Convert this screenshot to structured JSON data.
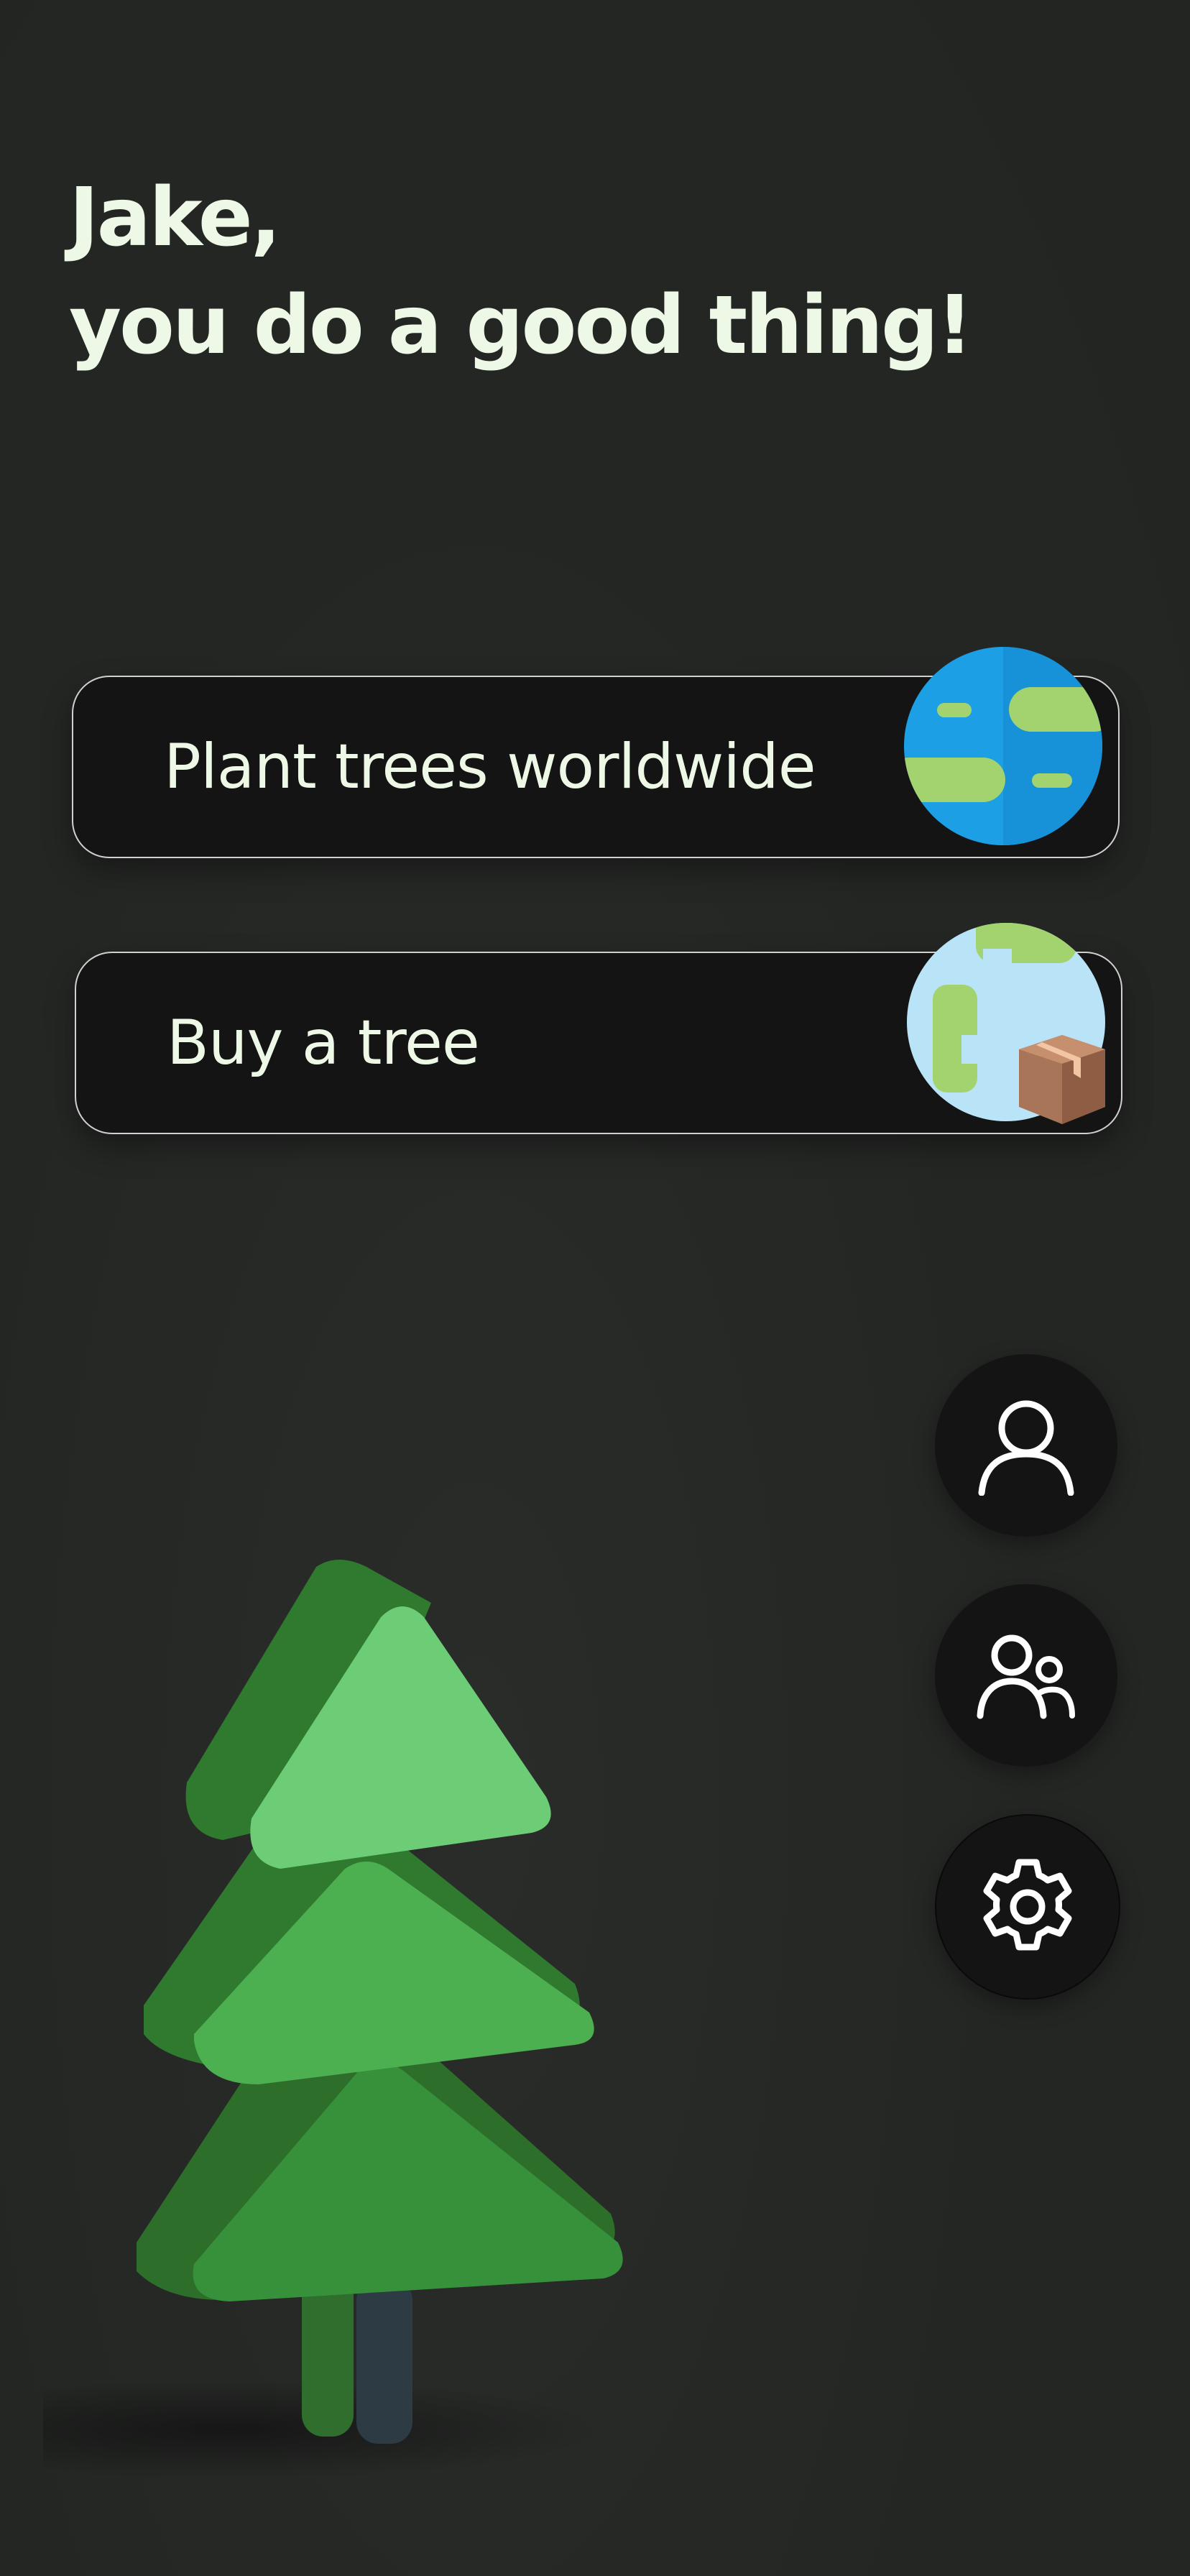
{
  "greeting": {
    "line1": "Jake,",
    "line2": "you do a good thing!"
  },
  "actions": [
    {
      "label": "Plant trees worldwide",
      "icon": "globe-icon"
    },
    {
      "label": "Buy a tree",
      "icon": "globe-package-icon"
    }
  ],
  "side_buttons": [
    {
      "name": "profile",
      "icon": "user-icon"
    },
    {
      "name": "friends",
      "icon": "users-icon"
    },
    {
      "name": "settings",
      "icon": "gear-icon"
    }
  ],
  "illustration": {
    "name": "tree-3d-illustration"
  },
  "colors": {
    "background": "#252725",
    "card": "#141414",
    "text": "#eef8e6",
    "accent_green": "#4caf50"
  }
}
